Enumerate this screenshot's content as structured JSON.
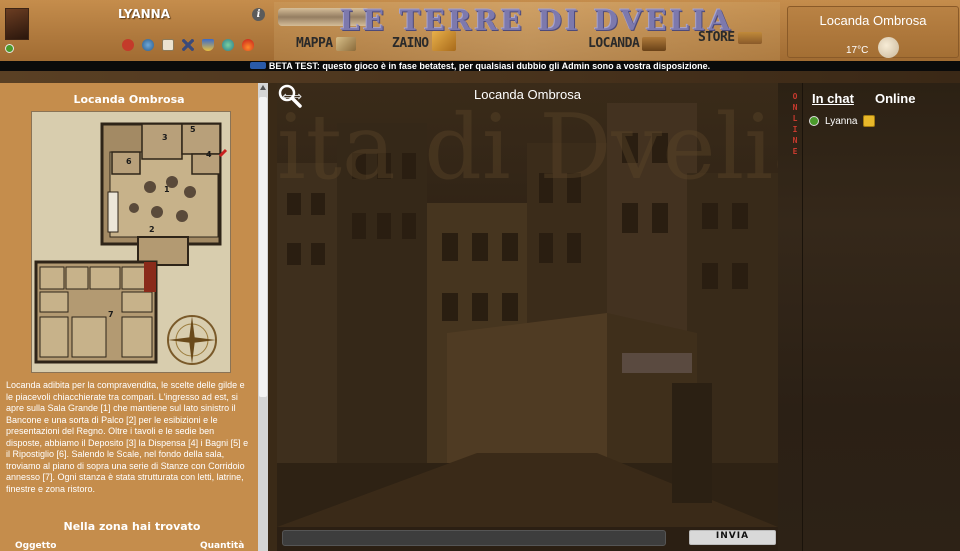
{
  "player": {
    "name": "LYANNA",
    "info_symbol": "i",
    "status_icons": [
      "lips-icon",
      "globe-icon",
      "scroll-icon",
      "swords-icon",
      "shield-icon",
      "gem-icon",
      "fire-icon"
    ]
  },
  "header": {
    "game_title": "LE TERRE DI DVELIA",
    "nav": {
      "map": "MAPPA",
      "backpack": "ZAINO",
      "inn": "LOCANDA",
      "store": "STORE"
    },
    "current_location": "Locanda Ombrosa",
    "temperature": "17°C",
    "weather": "cloudy-icon"
  },
  "notice": {
    "text": "BETA TEST: questo gioco è in fase betatest, per qualsiasi dubbio gli Admin sono a vostra disposizione."
  },
  "location": {
    "title": "Locanda Ombrosa",
    "map_labels": [
      "1",
      "2",
      "3",
      "4",
      "5",
      "6",
      "7"
    ],
    "description": "Locanda adibita per la compravendita, le scelte delle gilde e le piacevoli chiacchierate tra compari. L'ingresso ad est, si apre sulla Sala Grande [1] che mantiene sul lato sinistro il Bancone e una sorta di Palco [2] per le esibizioni e le presentazioni del Regno. Oltre i tavoli e le sedie ben disposte, abbiamo il Deposito [3] la Dispensa [4] i Bagni [5] e il Ripostiglio [6]. Salendo le Scale, nel fondo della sala, troviamo al piano di sopra una serie di Stanze con Corridoio annesso [7]. Ogni stanza è stata strutturata con letti, latrine, finestre e zona ristoro.",
    "found_title": "Nella zona hai trovato",
    "col_object": "Oggetto",
    "col_quantity": "Quantità"
  },
  "chat": {
    "title": "Locanda Ombrosa",
    "input_value": "",
    "send_label": "INVIA"
  },
  "sidebar": {
    "vertical_tab": "ONLINE",
    "tab_in_chat": "In chat",
    "tab_online": "Online",
    "users": [
      {
        "name": "Lyanna"
      }
    ]
  },
  "colors": {
    "panel": "#c58d4c",
    "notice_bg": "#0a0a0a",
    "title_purple": "#7d79ad",
    "online_green": "#4a9a2c",
    "vertical_tab_red": "#c83a2e"
  }
}
